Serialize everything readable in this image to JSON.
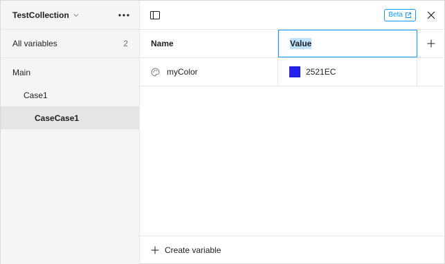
{
  "sidebar": {
    "collection_name": "TestCollection",
    "all_variables_label": "All variables",
    "all_variables_count": "2",
    "groups": [
      {
        "label": "Main"
      },
      {
        "label": "Case1"
      },
      {
        "label": "CaseCase1"
      }
    ]
  },
  "topbar": {
    "beta_label": "Beta"
  },
  "table": {
    "headers": {
      "name": "Name",
      "value": "Value"
    },
    "rows": [
      {
        "name": "myColor",
        "value": "2521EC",
        "swatch_color": "#2521EC",
        "type_icon": "palette-icon"
      }
    ]
  },
  "footer": {
    "create_label": "Create variable"
  },
  "colors": {
    "accent": "#0D99FF",
    "selected_row": "#E5E5E5",
    "sidebar_bg": "#F5F5F5"
  }
}
